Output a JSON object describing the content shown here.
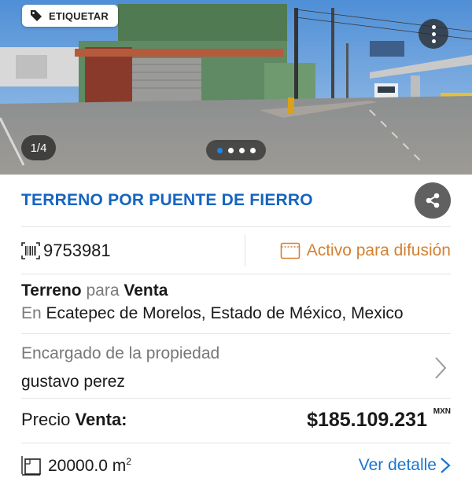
{
  "photo": {
    "tag_button_label": "ETIQUETAR",
    "counter": "1/4",
    "dots_total": 4,
    "dots_active_index": 0
  },
  "listing": {
    "title": "TERRENO POR PUENTE DE FIERRO",
    "id": "9753981",
    "status": "Activo para difusión",
    "type": "Terreno",
    "type_connector": "para",
    "operation": "Venta",
    "location_prefix": "En",
    "location": "Ecatepec de Morelos, Estado de México, Mexico",
    "agent_label": "Encargado de la propiedad",
    "agent_name": "gustavo perez",
    "price_label": "Precio",
    "price_operation": "Venta:",
    "price": "$185.109.231",
    "currency": "MXN",
    "area_value": "20000.0 m",
    "area_unit_exp": "2",
    "details_link": "Ver detalle"
  },
  "colors": {
    "title": "#1565c0",
    "status": "#d38131",
    "link": "#1976d2",
    "share_bg": "#606060"
  },
  "icons": [
    "tag-icon",
    "more-vertical-icon",
    "share-icon",
    "barcode-icon",
    "calendar-icon",
    "chevron-right-icon",
    "area-icon"
  ]
}
